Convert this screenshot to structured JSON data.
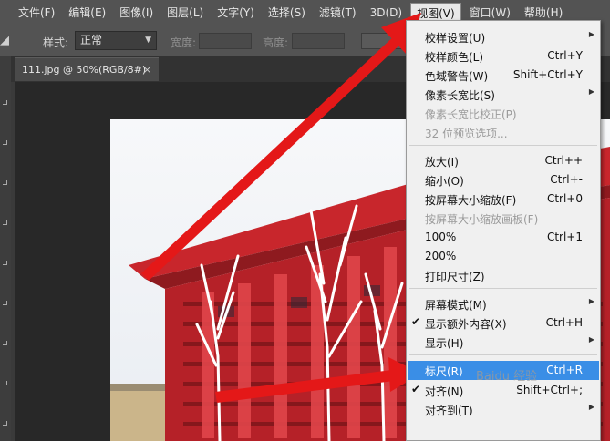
{
  "menubar": {
    "items": [
      "文件(F)",
      "编辑(E)",
      "图像(I)",
      "图层(L)",
      "文字(Y)",
      "选择(S)",
      "滤镜(T)",
      "3D(D)",
      "视图(V)",
      "窗口(W)",
      "帮助(H)"
    ],
    "active_index": 8
  },
  "options": {
    "style_label": "样式:",
    "style_value": "正常",
    "width_label": "宽度:",
    "height_label": "高度:"
  },
  "document": {
    "tab_title": "111.jpg @ 50%(RGB/8#)",
    "close_glyph": "×"
  },
  "view_menu": {
    "items": [
      {
        "label": "校样设置(U)",
        "shortcut": "",
        "submenu": true,
        "disabled": false,
        "checked": false,
        "highlighted": false
      },
      {
        "label": "校样颜色(L)",
        "shortcut": "Ctrl+Y",
        "submenu": false,
        "disabled": false,
        "checked": false,
        "highlighted": false
      },
      {
        "label": "色域警告(W)",
        "shortcut": "Shift+Ctrl+Y",
        "submenu": false,
        "disabled": false,
        "checked": false,
        "highlighted": false
      },
      {
        "label": "像素长宽比(S)",
        "shortcut": "",
        "submenu": true,
        "disabled": false,
        "checked": false,
        "highlighted": false
      },
      {
        "label": "像素长宽比校正(P)",
        "shortcut": "",
        "submenu": false,
        "disabled": true,
        "checked": false,
        "highlighted": false
      },
      {
        "label": "32 位预览选项...",
        "shortcut": "",
        "submenu": false,
        "disabled": true,
        "checked": false,
        "highlighted": false
      },
      {
        "label": "放大(I)",
        "shortcut": "Ctrl++",
        "submenu": false,
        "disabled": false,
        "checked": false,
        "highlighted": false
      },
      {
        "label": "缩小(O)",
        "shortcut": "Ctrl+-",
        "submenu": false,
        "disabled": false,
        "checked": false,
        "highlighted": false
      },
      {
        "label": "按屏幕大小缩放(F)",
        "shortcut": "Ctrl+0",
        "submenu": false,
        "disabled": false,
        "checked": false,
        "highlighted": false
      },
      {
        "label": "按屏幕大小缩放画板(F)",
        "shortcut": "",
        "submenu": false,
        "disabled": true,
        "checked": false,
        "highlighted": false
      },
      {
        "label": "100%",
        "shortcut": "Ctrl+1",
        "submenu": false,
        "disabled": false,
        "checked": false,
        "highlighted": false
      },
      {
        "label": "200%",
        "shortcut": "",
        "submenu": false,
        "disabled": false,
        "checked": false,
        "highlighted": false
      },
      {
        "label": "打印尺寸(Z)",
        "shortcut": "",
        "submenu": false,
        "disabled": false,
        "checked": false,
        "highlighted": false
      },
      {
        "label": "屏幕模式(M)",
        "shortcut": "",
        "submenu": true,
        "disabled": false,
        "checked": false,
        "highlighted": false
      },
      {
        "label": "显示额外内容(X)",
        "shortcut": "Ctrl+H",
        "submenu": false,
        "disabled": false,
        "checked": true,
        "highlighted": false
      },
      {
        "label": "显示(H)",
        "shortcut": "",
        "submenu": true,
        "disabled": false,
        "checked": false,
        "highlighted": false
      },
      {
        "label": "标尺(R)",
        "shortcut": "Ctrl+R",
        "submenu": false,
        "disabled": false,
        "checked": false,
        "highlighted": true
      },
      {
        "label": "对齐(N)",
        "shortcut": "Shift+Ctrl+;",
        "submenu": false,
        "disabled": false,
        "checked": true,
        "highlighted": false
      },
      {
        "label": "对齐到(T)",
        "shortcut": "",
        "submenu": true,
        "disabled": false,
        "checked": false,
        "highlighted": false
      }
    ]
  },
  "icons": {
    "submenu": "submenu-arrow-icon",
    "check": "checkmark-icon",
    "dropdown": "chevron-down-icon"
  },
  "colors": {
    "highlight": "#3a8ee6",
    "annotation_arrow": "#e41818",
    "building_red": "#c8262c"
  }
}
